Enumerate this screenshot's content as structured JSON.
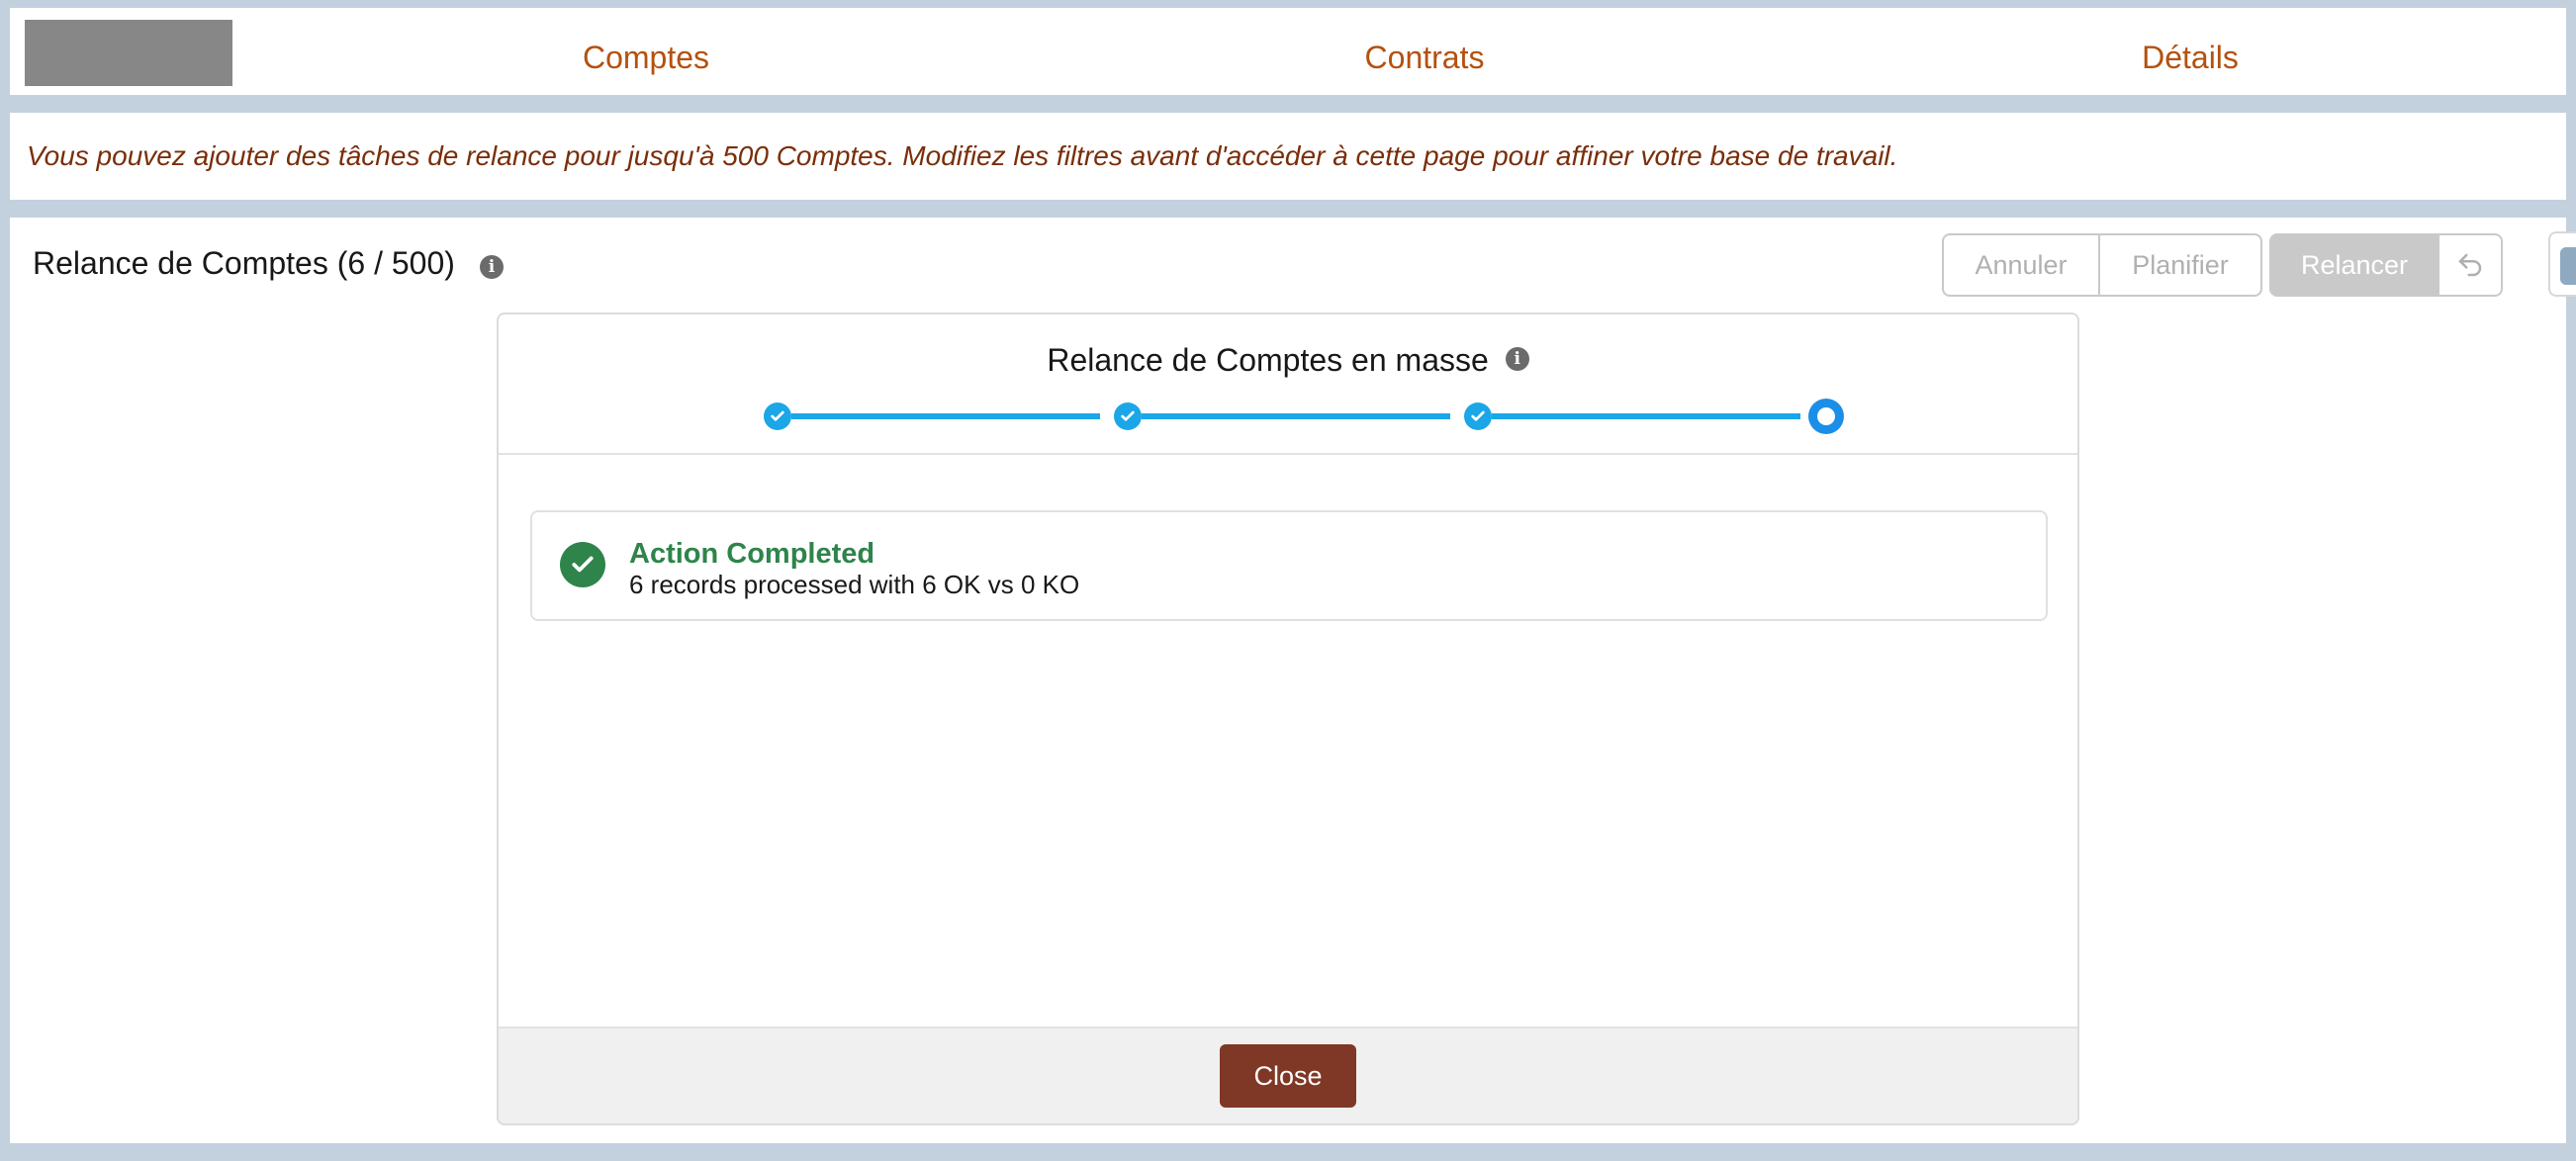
{
  "nav": {
    "items": [
      {
        "label": "Comptes"
      },
      {
        "label": "Contrats"
      },
      {
        "label": "Détails"
      }
    ]
  },
  "banner": {
    "text": "Vous pouvez ajouter des tâches de relance pour jusqu'à 500 Comptes. Modifiez les filtres avant d'accéder à cette page pour affiner votre base de travail."
  },
  "main": {
    "title": "Relance de Comptes (6 / 500)",
    "info_icon": "info-icon",
    "buttons": {
      "annuler": "Annuler",
      "planifier": "Planifier",
      "relancer": "Relancer",
      "undo_icon": "undo-icon"
    }
  },
  "wizard": {
    "title": "Relance de Comptes en masse",
    "steps_total": 4,
    "current_step": 4,
    "result": {
      "title": "Action Completed",
      "message": "6 records processed with 6 OK vs 0 KO"
    },
    "close_label": "Close"
  },
  "colors": {
    "accent": "#b4510f",
    "banner_text": "#7a2e0a",
    "progress": "#1ba6e8",
    "success": "#2e844a",
    "close_button": "#7f3825",
    "page_bg": "#c3d1de"
  }
}
